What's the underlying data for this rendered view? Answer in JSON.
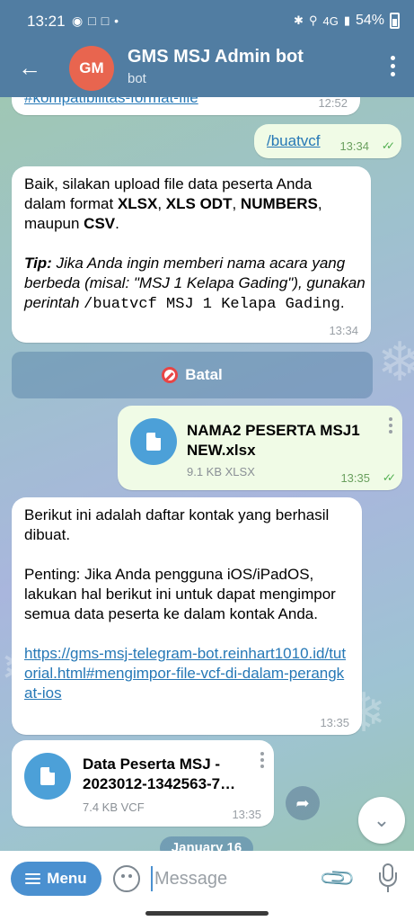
{
  "status_bar": {
    "time": "13:21",
    "battery": "54%",
    "network": "4G"
  },
  "header": {
    "avatar_initials": "GM",
    "title": "GMS MSJ Admin bot",
    "subtitle": "bot"
  },
  "messages": {
    "m0": {
      "text": "#kompatibilitas-format-file",
      "time": "12:52"
    },
    "m1": {
      "text": "/buatvcf",
      "time": "13:34"
    },
    "m2": {
      "line1": "Baik, silakan upload file data peserta Anda",
      "line2_a": "dalam format ",
      "fmt1": "XLSX",
      "sep1": ", ",
      "fmt2": "XLS ODT",
      "sep2": ", ",
      "fmt3": "NUMBERS",
      "sep3": ",",
      "line3_a": "maupun ",
      "fmt4": "CSV",
      "line3_b": ".",
      "tip_label": "Tip:",
      "tip_text": " Jika Anda ingin memberi nama acara yang berbeda (misal: \"MSJ 1 Kelapa Gading\"), gunakan perintah ",
      "tip_cmd": "/buatvcf MSJ 1 Kelapa Gading",
      "tip_end": ".",
      "time": "13:34"
    },
    "cancel_button": "Batal",
    "m3": {
      "file_name": "NAMA2 PESERTA MSJ1 NEW.xlsx",
      "file_size": "9.1 KB XLSX",
      "time": "13:35"
    },
    "m4": {
      "p1": "Berikut ini adalah daftar kontak yang berhasil dibuat.",
      "p2": "Penting: Jika Anda pengguna iOS/iPadOS, lakukan hal berikut ini untuk dapat mengimpor semua data peserta ke dalam kontak Anda.",
      "link": "https://gms-msj-telegram-bot.reinhart1010.id/tutorial.html#mengimpor-file-vcf-di-dalam-perangkat-ios",
      "time": "13:35"
    },
    "m5": {
      "file_name": "Data Peserta MSJ - 2023012-1342563-7…",
      "file_size": "7.4 KB VCF",
      "time": "13:35"
    },
    "date_separator": "January 16"
  },
  "input_bar": {
    "menu_label": "Menu",
    "placeholder": "Message"
  },
  "icons": {
    "back": "arrow-left-icon",
    "more": "kebab-icon",
    "file": "file-icon",
    "share": "share-icon",
    "scroll_down": "chevron-down-icon",
    "emoji": "emoji-icon",
    "attach": "paperclip-icon",
    "mic": "mic-icon",
    "cancel": "no-entry-icon"
  },
  "colors": {
    "header": "#517da2",
    "avatar": "#e8654f",
    "outgoing_bubble": "#f0fbe6",
    "link": "#2678b6",
    "accent": "#4a90d0"
  }
}
